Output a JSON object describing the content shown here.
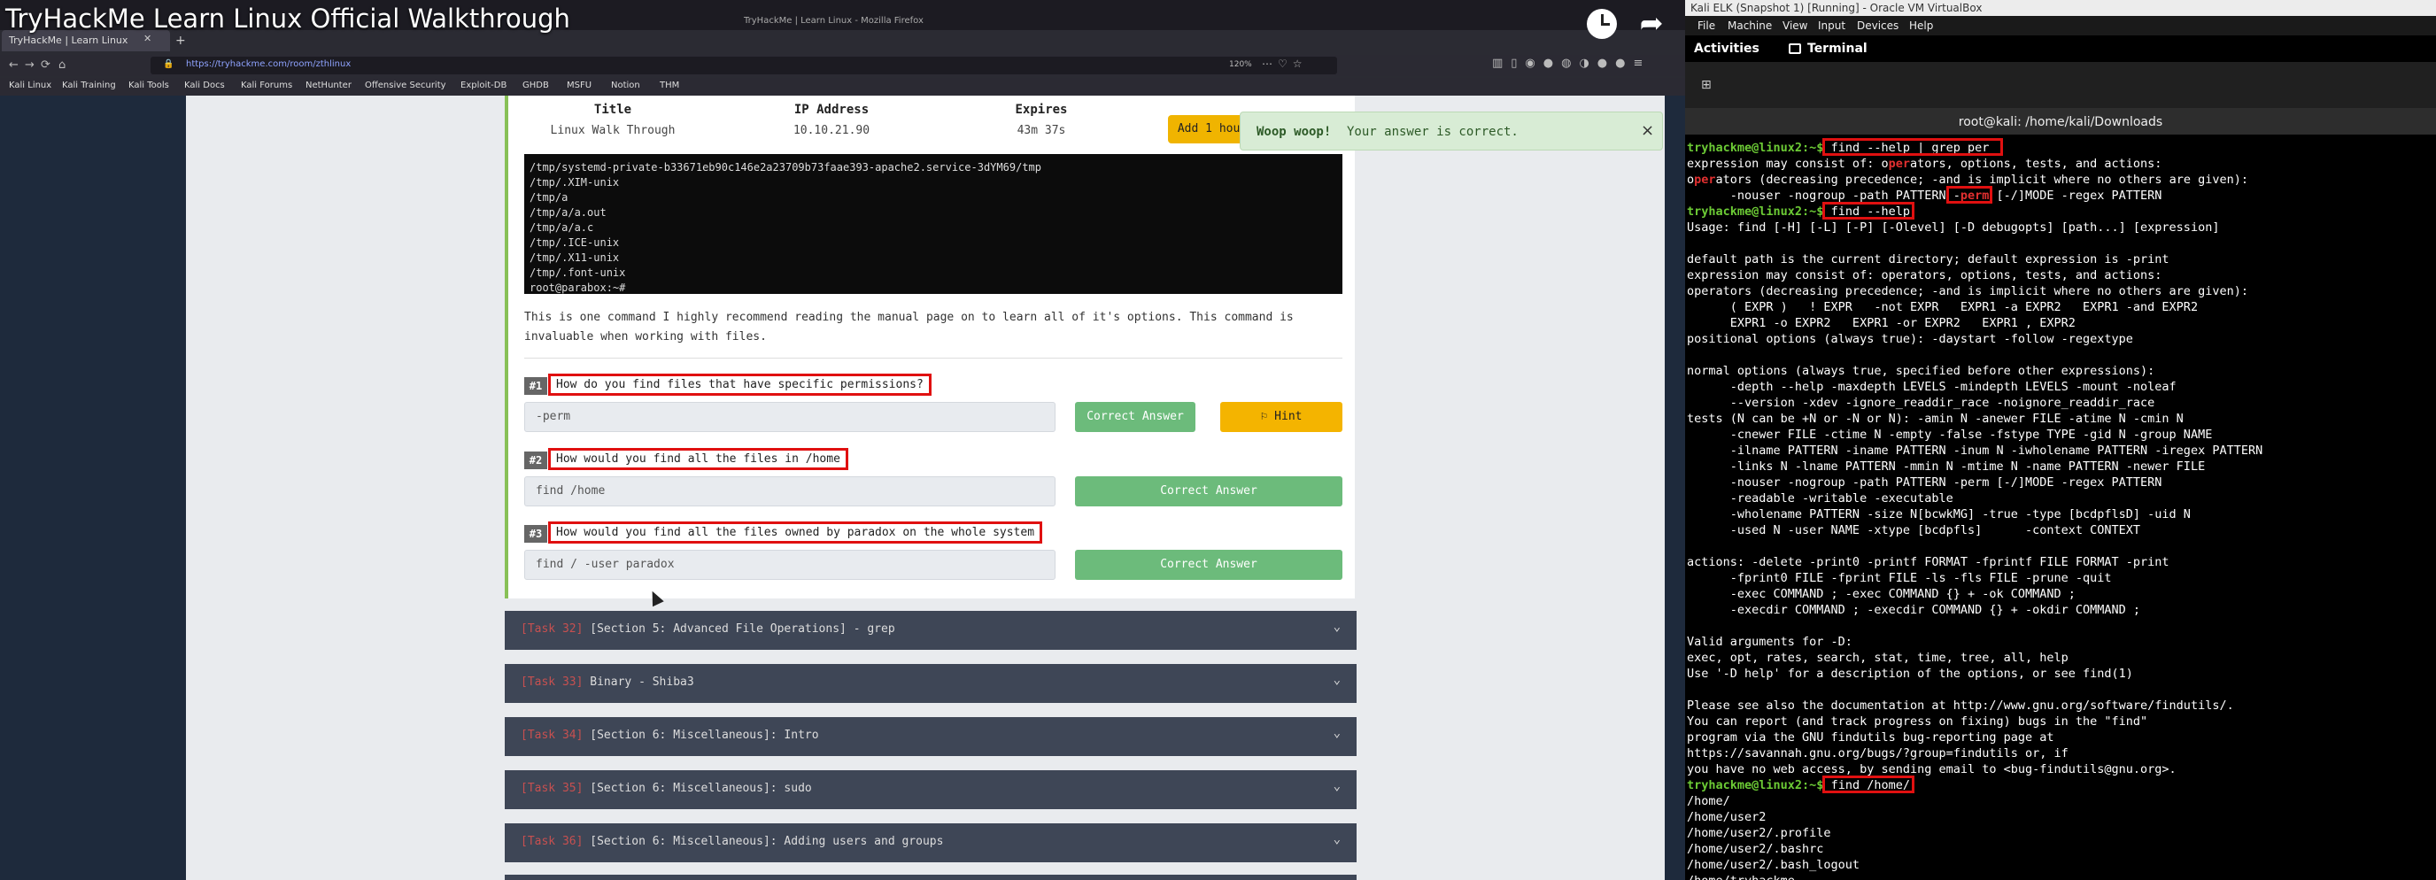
{
  "video": {
    "title": "TryHackMe Learn Linux Official Walkthrough",
    "watch_later_label": "",
    "share_label": ""
  },
  "firefox": {
    "window_title": "TryHackMe | Learn Linux - Mozilla Firefox",
    "tab_title": "TryHackMe | Learn Linux",
    "url": "https://tryhackme.com/room/zthlinux",
    "zoom": "120%",
    "bookmarks": [
      "Kali Linux",
      "Kali Training",
      "Kali Tools",
      "Kali Docs",
      "Kali Forums",
      "NetHunter",
      "Offensive Security",
      "Exploit-DB",
      "GHDB",
      "MSFU",
      "Notion",
      "THM"
    ]
  },
  "machine": {
    "title_header": "Title",
    "title_value": "Linux Walk Through",
    "ip_header": "IP Address",
    "ip_value": "10.10.21.90",
    "expires_header": "Expires",
    "expires_value": "43m 37s",
    "add_hour_label": "Add 1 hour"
  },
  "toast": {
    "strong": "Woop woop!",
    "text": "Your answer is correct.",
    "close": "×"
  },
  "terminal_output": [
    "/tmp/systemd-private-b33671eb90c146e2a23709b73faae393-apache2.service-3dYM69/tmp",
    "/tmp/.XIM-unix",
    "/tmp/a",
    "/tmp/a/a.out",
    "/tmp/a/a.c",
    "/tmp/.ICE-unix",
    "/tmp/.X11-unix",
    "/tmp/.font-unix",
    "root@parabox:~#"
  ],
  "description": "This is one command I highly recommend reading the manual page on to learn all of it's options. This command is invaluable when working with files.",
  "questions": [
    {
      "num": "#1",
      "text": "How do you find files that have specific permissions?",
      "answer": "-perm",
      "button": "Correct Answer",
      "hint": "Hint"
    },
    {
      "num": "#2",
      "text": "How would you find all the files in /home",
      "answer": "find /home",
      "button": "Correct Answer"
    },
    {
      "num": "#3",
      "text": "How would you find all the files owned by paradox on the whole system",
      "answer": "find / -user paradox",
      "button": "Correct Answer"
    }
  ],
  "tasks": [
    {
      "num": "[Task 32]",
      "name": "[Section 5: Advanced File Operations] - grep"
    },
    {
      "num": "[Task 33]",
      "name": "Binary - Shiba3"
    },
    {
      "num": "[Task 34]",
      "name": "[Section 6: Miscellaneous]: Intro"
    },
    {
      "num": "[Task 35]",
      "name": "[Section 6: Miscellaneous]: sudo"
    },
    {
      "num": "[Task 36]",
      "name": "[Section 6: Miscellaneous]: Adding users and groups"
    }
  ],
  "vm": {
    "window_title": "Kali ELK (Snapshot 1) [Running] - Oracle VM VirtualBox",
    "menu": [
      "File",
      "Machine",
      "View",
      "Input",
      "Devices",
      "Help"
    ],
    "activities": "Activities",
    "terminal_app": "Terminal",
    "terminal_title": "root@kali: /home/kali/Downloads"
  },
  "shell": {
    "prompt": "tryhackme@linux2:~$",
    "cmd1": " find --help | grep per",
    "grep_lines": [
      [
        "expression may consist of: o",
        "per",
        "ators, options, tests, and actions:"
      ],
      [
        "o",
        "per",
        "ators (decreasing precedence; -and is implicit where no others are given):"
      ],
      [
        "      -nouser -nogroup -path PATTERN -",
        "perm",
        " [-/]MODE -regex PATTERN"
      ]
    ],
    "cmd2": " find --help",
    "help_lines": [
      "Usage: find [-H] [-L] [-P] [-Olevel] [-D debugopts] [path...] [expression]",
      "",
      "default path is the current directory; default expression is -print",
      "expression may consist of: operators, options, tests, and actions:",
      "operators (decreasing precedence; -and is implicit where no others are given):",
      "      ( EXPR )   ! EXPR   -not EXPR   EXPR1 -a EXPR2   EXPR1 -and EXPR2",
      "      EXPR1 -o EXPR2   EXPR1 -or EXPR2   EXPR1 , EXPR2",
      "positional options (always true): -daystart -follow -regextype",
      "",
      "normal options (always true, specified before other expressions):",
      "      -depth --help -maxdepth LEVELS -mindepth LEVELS -mount -noleaf",
      "      --version -xdev -ignore_readdir_race -noignore_readdir_race",
      "tests (N can be +N or -N or N): -amin N -anewer FILE -atime N -cmin N",
      "      -cnewer FILE -ctime N -empty -false -fstype TYPE -gid N -group NAME",
      "      -ilname PATTERN -iname PATTERN -inum N -iwholename PATTERN -iregex PATTERN",
      "      -links N -lname PATTERN -mmin N -mtime N -name PATTERN -newer FILE",
      "      -nouser -nogroup -path PATTERN -perm [-/]MODE -regex PATTERN",
      "      -readable -writable -executable",
      "      -wholename PATTERN -size N[bcwkMG] -true -type [bcdpflsD] -uid N",
      "      -used N -user NAME -xtype [bcdpfls]      -context CONTEXT",
      "",
      "actions: -delete -print0 -printf FORMAT -fprintf FILE FORMAT -print",
      "      -fprint0 FILE -fprint FILE -ls -fls FILE -prune -quit",
      "      -exec COMMAND ; -exec COMMAND {} + -ok COMMAND ;",
      "      -execdir COMMAND ; -execdir COMMAND {} + -okdir COMMAND ;",
      "",
      "Valid arguments for -D:",
      "exec, opt, rates, search, stat, time, tree, all, help",
      "Use '-D help' for a description of the options, or see find(1)",
      "",
      "Please see also the documentation at http://www.gnu.org/software/findutils/.",
      "You can report (and track progress on fixing) bugs in the \"find\"",
      "program via the GNU findutils bug-reporting page at",
      "https://savannah.gnu.org/bugs/?group=findutils or, if",
      "you have no web access, by sending email to <bug-findutils@gnu.org>."
    ],
    "cmd3": " find /home/",
    "home_lines": [
      "/home/",
      "/home/user2",
      "/home/user2/.profile",
      "/home/user2/.bashrc",
      "/home/user2/.bash_logout",
      "/home/tryhackme"
    ]
  }
}
